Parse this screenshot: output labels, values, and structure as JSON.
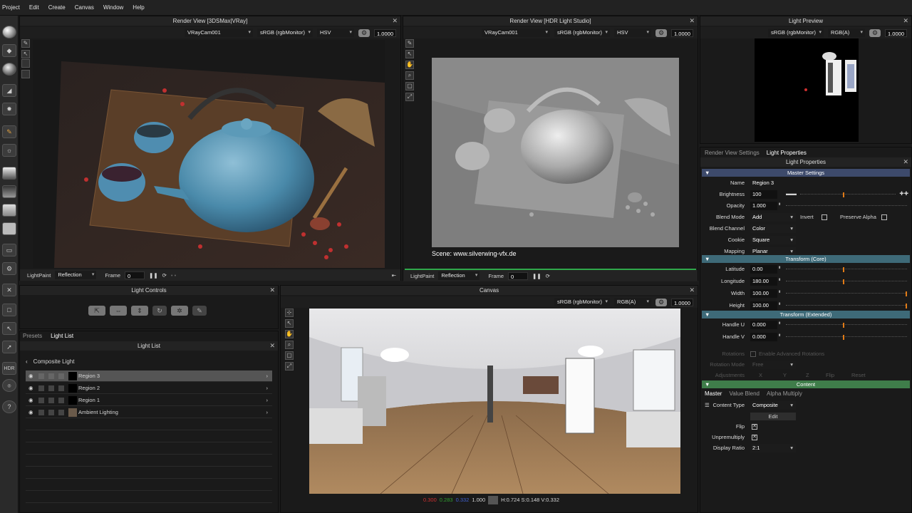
{
  "menu": [
    "Project",
    "Edit",
    "Create",
    "Canvas",
    "Window",
    "Help"
  ],
  "render1": {
    "title": "Render View [3DSMax|VRay]",
    "camera": "VRayCam001",
    "color_space": "sRGB (rgbMonitor)",
    "channel": "HSV",
    "value": "1.0000",
    "mode_label": "LightPaint",
    "mode_value": "Reflection",
    "frame_label": "Frame",
    "frame_value": "0"
  },
  "render2": {
    "title": "Render View [HDR Light Studio]",
    "camera": "VRayCam001",
    "color_space": "sRGB (rgbMonitor)",
    "channel": "HSV",
    "value": "1.0000",
    "scene_caption": "Scene: www.silverwing-vfx.de",
    "mode_label": "LightPaint",
    "mode_value": "Reflection",
    "frame_label": "Frame",
    "frame_value": "0"
  },
  "preview": {
    "title": "Light Preview",
    "color_space": "sRGB (rgbMonitor)",
    "channel": "RGB(A)",
    "value": "1.0000"
  },
  "light_controls": {
    "title": "Light Controls"
  },
  "light_list": {
    "tabs": [
      "Presets",
      "Light List"
    ],
    "title": "Light List",
    "composite_label": "Composite Light",
    "items": [
      {
        "label": "Region 3",
        "selected": true
      },
      {
        "label": "Region 2",
        "selected": false
      },
      {
        "label": "Region 1",
        "selected": false
      },
      {
        "label": "Ambient Lighting",
        "selected": false
      }
    ]
  },
  "canvas": {
    "title": "Canvas",
    "color_space": "sRGB (rgbMonitor)",
    "channel": "RGB(A)",
    "value": "1.0000",
    "readout_r": "0.300",
    "readout_g": "0.283",
    "readout_b": "0.332",
    "readout_a": "1.000",
    "readout_hsv": "H:0.724 S:0.148 V:0.332",
    "colors": {
      "r": "#d03030",
      "g": "#30a030",
      "b": "#4060d0"
    }
  },
  "props": {
    "tabs": [
      "Render View Settings",
      "Light Properties"
    ],
    "title": "Light Properties",
    "master_header": "Master Settings",
    "name_label": "Name",
    "name_value": "Region 3",
    "brightness_label": "Brightness",
    "brightness_value": "100",
    "brightness_level": 0.45,
    "opacity_label": "Opacity",
    "opacity_value": "1.000",
    "blend_mode_label": "Blend Mode",
    "blend_mode_value": "Add",
    "invert_label": "Invert",
    "preserve_alpha_label": "Preserve Alpha",
    "blend_channel_label": "Blend Channel",
    "blend_channel_value": "Color",
    "cookie_label": "Cookie",
    "cookie_value": "Square",
    "mapping_label": "Mapping",
    "mapping_value": "Planar",
    "transform_core_header": "Transform (Core)",
    "latitude_label": "Latitude",
    "latitude_value": "0.00",
    "longitude_label": "Longitude",
    "longitude_value": "180.00",
    "width_label": "Width",
    "width_value": "100.00",
    "height_label": "Height",
    "height_value": "100.00",
    "transform_ext_header": "Transform (Extended)",
    "handle_u_label": "Handle U",
    "handle_u_value": "0.000",
    "handle_v_label": "Handle V",
    "handle_v_value": "0.000",
    "rotations_label": "Rotations",
    "enable_rot_label": "Enable Advanced Rotations",
    "rotation_mode_label": "Rotation Mode",
    "rotation_mode_value": "Free",
    "adjustments_label": "Adjustments",
    "adj_x": "X",
    "adj_y": "Y",
    "adj_z": "Z",
    "flip_btn": "Flip",
    "reset_btn": "Reset",
    "content_header": "Content",
    "content_tabs": [
      "Master",
      "Value Blend",
      "Alpha Multiply"
    ],
    "content_type_label": "Content Type",
    "content_type_value": "Composite",
    "edit_btn": "Edit",
    "flip_label": "Flip",
    "unpremultiply_label": "Unpremultiply",
    "display_ratio_label": "Display Ratio",
    "display_ratio_value": "2:1",
    "colors": {
      "master": "#3d4a6b",
      "transform": "#3e6a78",
      "content": "#3f7d4a",
      "knob": "#e07a16"
    }
  },
  "toolbar_icons": [
    "sphere-diffuse-icon",
    "sphere-gradient-icon",
    "sphere-soft-icon",
    "eraser-icon",
    "lens-icon",
    "brush-icon",
    "light-icon",
    "strip-icon",
    "strip-dark-icon",
    "strip-white-icon",
    "rect-icon",
    "folder-icon",
    "gear-icon",
    "close-icon",
    "square-icon",
    "paint-icon",
    "cursor-icon",
    "hdr-icon",
    "hdr-globe-icon",
    "help-icon"
  ],
  "toolbar_labels": {
    "hdr": "HDR",
    "help": "?"
  }
}
